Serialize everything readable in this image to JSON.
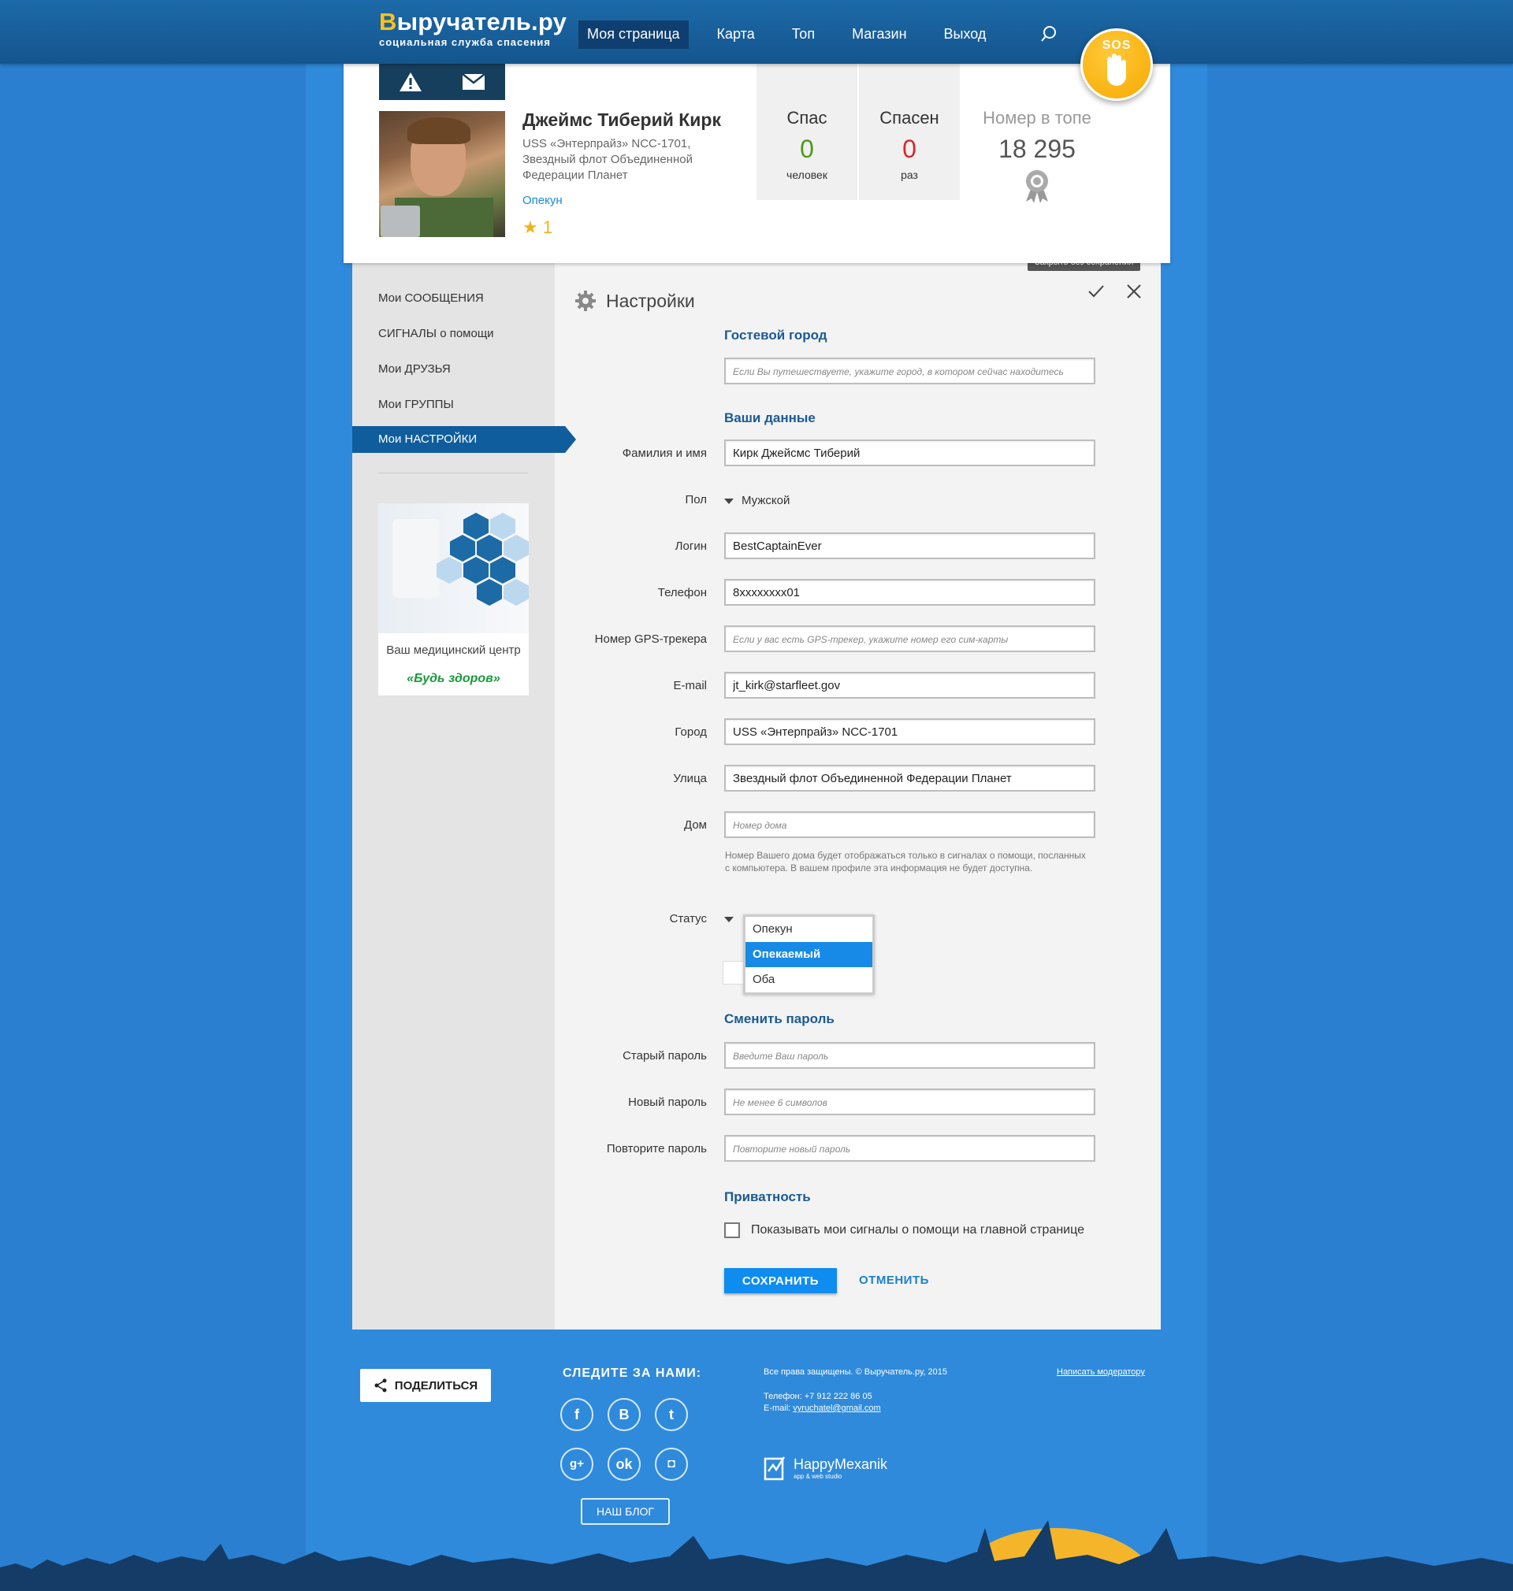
{
  "header": {
    "logo_title_rest": "ыручатель.ру",
    "logo_title_first": "В",
    "logo_subtitle": "социальная служба спасения",
    "nav": [
      "Моя страница",
      "Карта",
      "Топ",
      "Магазин",
      "Выход"
    ],
    "sos": "SOS"
  },
  "profile": {
    "name": "Джеймс Тиберий Кирк",
    "description": "USS «Энтерпрайз» NCC-1701, Звездный флот Объединенной Федерации Планет",
    "role": "Опекун",
    "stars": "1",
    "stats": [
      {
        "title": "Спас",
        "value": "0",
        "unit": "человек",
        "color": "#4c9a1a"
      },
      {
        "title": "Спасен",
        "value": "0",
        "unit": "раз",
        "color": "#d22b2b"
      }
    ],
    "rank_title": "Номер в топе",
    "rank_value": "18 295"
  },
  "sidebar": {
    "items": [
      "Мои СООБЩЕНИЯ",
      "СИГНАЛЫ о помощи",
      "Мои ДРУЗЬЯ",
      "Мои ГРУППЫ",
      "Мои НАСТРОЙКИ"
    ],
    "active_index": 4,
    "ad_line1": "Ваш медицинский центр",
    "ad_line2": "«Будь здоров»"
  },
  "settings": {
    "title": "Настройки",
    "tooltip": "Закрыть без сохранения",
    "guest_city_title": "Гостевой город",
    "guest_city_placeholder": "Если Вы путешествуете, укажите город, в котором сейчас находитесь",
    "your_data_title": "Ваши данные",
    "fields": {
      "fullname": {
        "label": "Фамилия и имя",
        "value": "Кирк Джейсмс Тиберий"
      },
      "gender": {
        "label": "Пол",
        "value": "Мужской"
      },
      "login": {
        "label": "Логин",
        "value": "BestCaptainEver"
      },
      "phone": {
        "label": "Телефон",
        "value": "8xxxxxxxx01"
      },
      "gps": {
        "label": "Номер GPS-трекера",
        "placeholder": "Если у вас есть GPS-трекер, укажите номер его сим-карты"
      },
      "email": {
        "label": "E-mail",
        "value": "jt_kirk@starfleet.gov"
      },
      "city": {
        "label": "Город",
        "value": "USS «Энтерпрайз» NCC-1701"
      },
      "street": {
        "label": "Улица",
        "value": "Звездный флот Объединенной Федерации Планет"
      },
      "house": {
        "label": "Дом",
        "placeholder": "Номер дома"
      }
    },
    "house_hint": "Номер Вашего дома будет отображаться только в сигналах о помощи, посланных с компьютера. В вашем профиле эта информация не будет доступна.",
    "status_label": "Статус",
    "status_options": [
      "Опекун",
      "Опекаемый",
      "Оба"
    ],
    "status_selected_index": 1,
    "password_title": "Сменить пароль",
    "old_password": {
      "label": "Старый пароль",
      "placeholder": "Введите Ваш пароль"
    },
    "new_password": {
      "label": "Новый пароль",
      "placeholder": "Не менее 6 символов"
    },
    "repeat_password": {
      "label": "Повторите пароль",
      "placeholder": "Повторите новый пароль"
    },
    "privacy_title": "Приватность",
    "privacy_checkbox": "Показывать мои сигналы о помощи на главной странице",
    "privacy_checked": false,
    "save": "СОХРАНИТЬ",
    "cancel": "ОТМЕНИТЬ"
  },
  "footer": {
    "share": "ПОДЕЛИТЬСЯ",
    "follow": "СЛЕДИТЕ ЗА НАМИ:",
    "blog": "НАШ БЛОГ",
    "copyright": "Все права защищены. © Выручатель.ру, 2015",
    "phone": "Телефон: +7 912 222 86 05",
    "email_label": "E-mail: ",
    "email": "vyruchatel@gmail.com",
    "moderator_link": "Написать модератору",
    "studio_name": "HappyMexanik",
    "studio_sub": "app & web studio"
  },
  "colors": {
    "accent": "#0e8cf0",
    "header": "#14558e",
    "sos": "#f7a900"
  }
}
